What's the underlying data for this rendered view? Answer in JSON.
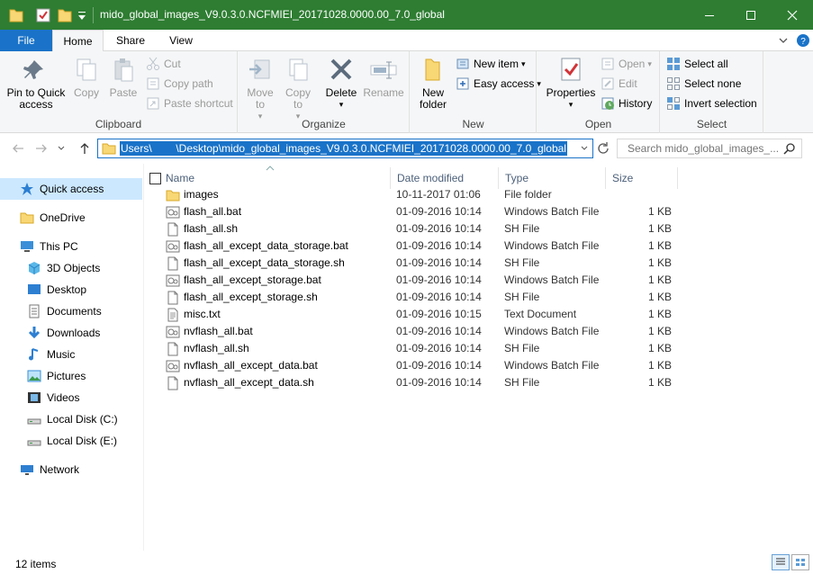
{
  "window": {
    "title": "mido_global_images_V9.0.3.0.NCFMIEI_20171028.0000.00_7.0_global",
    "accent": "#2e7d32"
  },
  "tabs": [
    "File",
    "Home",
    "Share",
    "View"
  ],
  "ribbon": {
    "clipboard": {
      "label": "Clipboard",
      "pin": "Pin to Quick access",
      "copy": "Copy",
      "paste": "Paste",
      "cut": "Cut",
      "copy_path": "Copy path",
      "paste_shortcut": "Paste shortcut"
    },
    "organize": {
      "label": "Organize",
      "move_to": "Move to",
      "copy_to": "Copy to",
      "delete": "Delete",
      "rename": "Rename"
    },
    "new": {
      "label": "New",
      "new_folder": "New folder",
      "new_item": "New item",
      "easy_access": "Easy access"
    },
    "open": {
      "label": "Open",
      "properties": "Properties",
      "open": "Open",
      "edit": "Edit",
      "history": "History"
    },
    "select": {
      "label": "Select",
      "select_all": "Select all",
      "select_none": "Select none",
      "invert": "Invert selection"
    }
  },
  "address": {
    "path": "Users\\        \\Desktop\\mido_global_images_V9.0.3.0.NCFMIEI_20171028.0000.00_7.0_global"
  },
  "search": {
    "placeholder": "Search mido_global_images_..."
  },
  "nav": [
    {
      "label": "Quick access",
      "icon": "star-icon",
      "selected": true
    },
    {
      "label": "OneDrive",
      "icon": "folder-icon"
    },
    {
      "label": "This PC",
      "icon": "pc-icon"
    },
    {
      "label": "3D Objects",
      "icon": "cube-icon"
    },
    {
      "label": "Desktop",
      "icon": "desktop-icon"
    },
    {
      "label": "Documents",
      "icon": "documents-icon"
    },
    {
      "label": "Downloads",
      "icon": "downloads-icon"
    },
    {
      "label": "Music",
      "icon": "music-icon"
    },
    {
      "label": "Pictures",
      "icon": "pictures-icon"
    },
    {
      "label": "Videos",
      "icon": "videos-icon"
    },
    {
      "label": "Local Disk (C:)",
      "icon": "drive-icon"
    },
    {
      "label": "Local Disk (E:)",
      "icon": "drive-icon"
    },
    {
      "label": "Network",
      "icon": "network-icon"
    }
  ],
  "columns": {
    "name": "Name",
    "date": "Date modified",
    "type": "Type",
    "size": "Size"
  },
  "files": [
    {
      "name": "images",
      "date": "10-11-2017 01:06",
      "type": "File folder",
      "size": "",
      "icon": "folder"
    },
    {
      "name": "flash_all.bat",
      "date": "01-09-2016 10:14",
      "type": "Windows Batch File",
      "size": "1 KB",
      "icon": "bat"
    },
    {
      "name": "flash_all.sh",
      "date": "01-09-2016 10:14",
      "type": "SH File",
      "size": "1 KB",
      "icon": "doc"
    },
    {
      "name": "flash_all_except_data_storage.bat",
      "date": "01-09-2016 10:14",
      "type": "Windows Batch File",
      "size": "1 KB",
      "icon": "bat"
    },
    {
      "name": "flash_all_except_data_storage.sh",
      "date": "01-09-2016 10:14",
      "type": "SH File",
      "size": "1 KB",
      "icon": "doc"
    },
    {
      "name": "flash_all_except_storage.bat",
      "date": "01-09-2016 10:14",
      "type": "Windows Batch File",
      "size": "1 KB",
      "icon": "bat"
    },
    {
      "name": "flash_all_except_storage.sh",
      "date": "01-09-2016 10:14",
      "type": "SH File",
      "size": "1 KB",
      "icon": "doc"
    },
    {
      "name": "misc.txt",
      "date": "01-09-2016 10:15",
      "type": "Text Document",
      "size": "1 KB",
      "icon": "txt"
    },
    {
      "name": "nvflash_all.bat",
      "date": "01-09-2016 10:14",
      "type": "Windows Batch File",
      "size": "1 KB",
      "icon": "bat"
    },
    {
      "name": "nvflash_all.sh",
      "date": "01-09-2016 10:14",
      "type": "SH File",
      "size": "1 KB",
      "icon": "doc"
    },
    {
      "name": "nvflash_all_except_data.bat",
      "date": "01-09-2016 10:14",
      "type": "Windows Batch File",
      "size": "1 KB",
      "icon": "bat"
    },
    {
      "name": "nvflash_all_except_data.sh",
      "date": "01-09-2016 10:14",
      "type": "SH File",
      "size": "1 KB",
      "icon": "doc"
    }
  ],
  "status": {
    "count": "12 items"
  }
}
